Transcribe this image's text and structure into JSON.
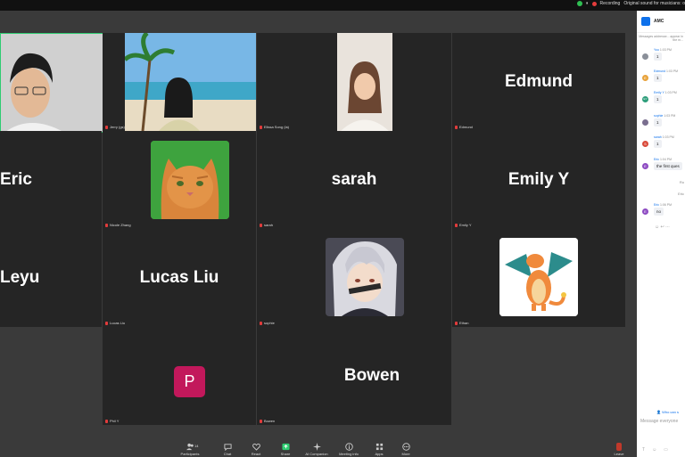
{
  "status_bar": {
    "recording_label": "Recording",
    "sound_label": "Original sound for musicians: o"
  },
  "tiles": [
    {
      "id": "t1",
      "name_label": "",
      "big_name": ""
    },
    {
      "id": "t2",
      "name_label": "Jerry (gs)",
      "big_name": ""
    },
    {
      "id": "t3",
      "name_label": "Elissa Song (la)",
      "big_name": ""
    },
    {
      "id": "t4",
      "name_label": "Edmund",
      "big_name": "Edmund"
    },
    {
      "id": "t5",
      "name_label": "",
      "big_name": "Eric"
    },
    {
      "id": "t6",
      "name_label": "Nicole Zhang",
      "big_name": ""
    },
    {
      "id": "t7",
      "name_label": "sarah",
      "big_name": "sarah"
    },
    {
      "id": "t8",
      "name_label": "Emily Y",
      "big_name": "Emily Y"
    },
    {
      "id": "t9",
      "name_label": "",
      "big_name": "Leyu"
    },
    {
      "id": "t10",
      "name_label": "Lucas Liu",
      "big_name": "Lucas Liu"
    },
    {
      "id": "t11",
      "name_label": "sophie",
      "big_name": ""
    },
    {
      "id": "t12",
      "name_label": "Ethan",
      "big_name": ""
    },
    {
      "id": "t13",
      "name_label": "Phil Y",
      "big_name": "",
      "letter": "P"
    },
    {
      "id": "t14",
      "name_label": "Bowen",
      "big_name": "Bowen"
    }
  ],
  "toolbar": {
    "participants_label": "Participants",
    "participants_count": "14",
    "chat_label": "Chat",
    "react_label": "React",
    "share_label": "Share",
    "ai_label": "AI Companion",
    "meeting_info_label": "Meeting info",
    "apps_label": "Apps",
    "more_label": "More",
    "leave_label": "Leave"
  },
  "chat": {
    "title": "AMC",
    "note": "Messages addresse... appear in the m...",
    "messages": [
      {
        "sender": "You",
        "time": "1:03 PM",
        "text": "1",
        "initial": "",
        "color": "#8a8f99"
      },
      {
        "sender": "Edmund",
        "time": "1:03 PM",
        "text": "1",
        "initial": "E",
        "color": "#e8a33b"
      },
      {
        "sender": "Emily Y",
        "time": "1:03 PM",
        "text": "1",
        "initial": "EY",
        "color": "#2e9e7b"
      },
      {
        "sender": "sophie",
        "time": "1:03 PM",
        "text": "1",
        "initial": "",
        "color": "#7a6e8f"
      },
      {
        "sender": "sarah",
        "time": "1:03 PM",
        "text": "1",
        "initial": "S",
        "color": "#d94a3a"
      },
      {
        "sender": "Eric",
        "time": "1:04 PM",
        "text": "the first ques",
        "initial": "E",
        "color": "#8d4bc2"
      },
      {
        "sender": "Eric",
        "time": "1:06 PM",
        "text": "no",
        "initial": "E",
        "color": "#8d4bc2"
      }
    ],
    "frag1": "Ro",
    "frag2": "Eric",
    "who_can": "Who can s",
    "placeholder": "Message everyone"
  }
}
